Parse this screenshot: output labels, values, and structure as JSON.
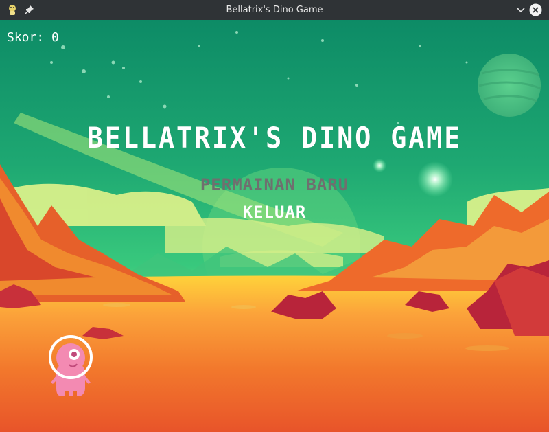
{
  "window": {
    "title": "Bellatrix's Dino Game",
    "icons": [
      "app-icon",
      "pin-icon",
      "minimize-icon",
      "close-icon"
    ]
  },
  "hud": {
    "score_text": "Skor: 0"
  },
  "menu": {
    "title": "BELLATRIX'S DINO GAME",
    "items": [
      {
        "label": "PERMAINAN BARU",
        "state": "highlighted"
      },
      {
        "label": "KELUAR",
        "state": "normal"
      }
    ]
  },
  "colors": {
    "sky_top": "#0e8f66",
    "sky_mid": "#2ec07a",
    "ground": "#f08a2a",
    "menu_highlight": "#6f6f6f",
    "menu_text": "#ffffff"
  }
}
